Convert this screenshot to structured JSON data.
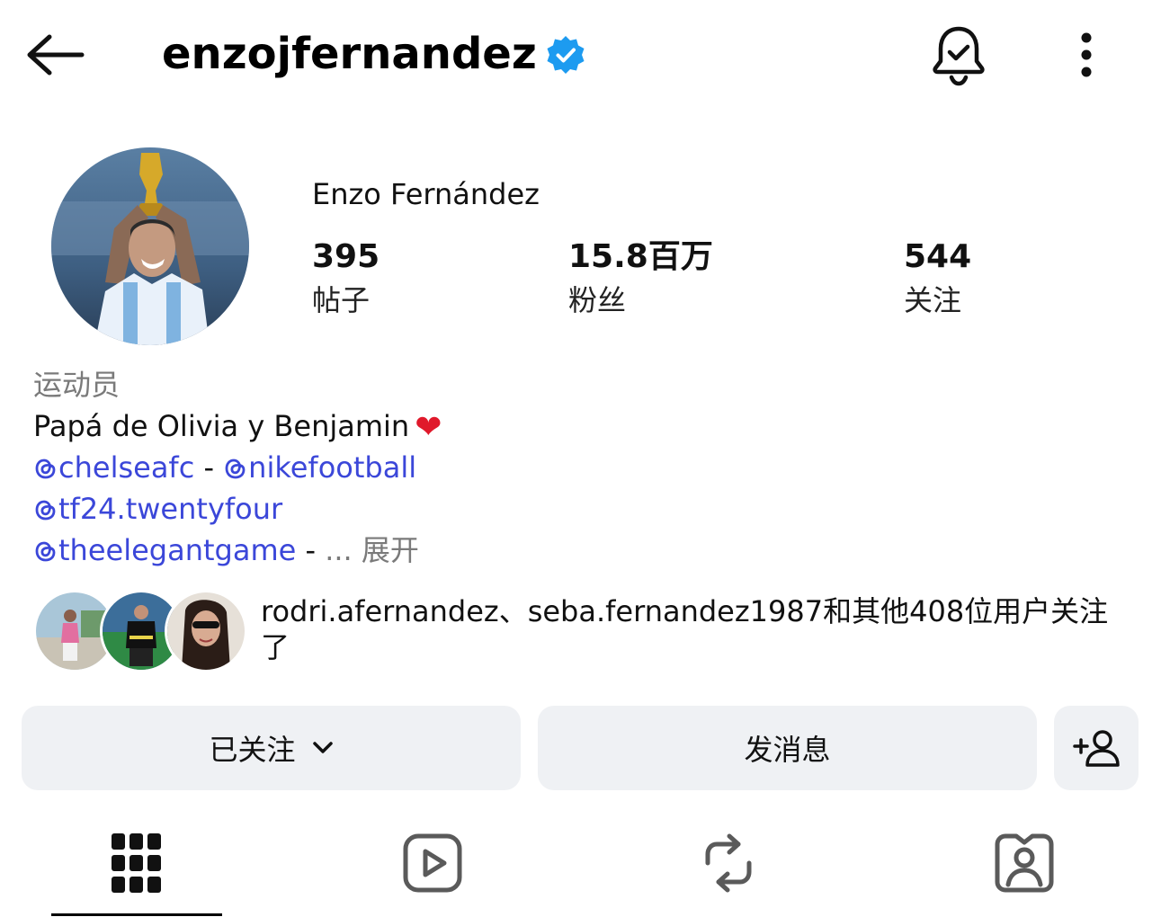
{
  "header": {
    "username": "enzojfernandez",
    "icons": {
      "back": "back-arrow-icon",
      "verified": "verified-badge-icon",
      "notifications": "bell-check-icon",
      "more": "more-vertical-icon"
    }
  },
  "profile": {
    "full_name": "Enzo Fernández",
    "stats": [
      {
        "value": "395",
        "label": "帖子"
      },
      {
        "value": "15.8百万",
        "label": "粉丝"
      },
      {
        "value": "544",
        "label": "关注"
      }
    ]
  },
  "bio": {
    "category": "运动员",
    "text": "Papá de Olivia y Benjamin",
    "emoji": "❤",
    "mentions": [
      "chelseafc",
      "nikefootball",
      "tf24.twentyfour",
      "theelegantgame"
    ],
    "separator": " - ",
    "ellipsis": "... ",
    "expand_label": "展开"
  },
  "followed_by": {
    "text": "rodri.afernandez、seba.fernandez1987和其他408位用户关注了"
  },
  "actions": {
    "following_label": "已关注",
    "message_label": "发消息",
    "add_user_icon": "add-user-icon"
  },
  "tabs": [
    {
      "icon": "grid-icon",
      "selected": true
    },
    {
      "icon": "reels-icon",
      "selected": false
    },
    {
      "icon": "reposts-icon",
      "selected": false
    },
    {
      "icon": "tagged-icon",
      "selected": false
    }
  ],
  "colors": {
    "link": "#3b47d9",
    "verified": "#1d9bf0",
    "heart": "#e0192b",
    "button_bg": "#eff1f4",
    "muted_text": "#7a7a7a"
  }
}
